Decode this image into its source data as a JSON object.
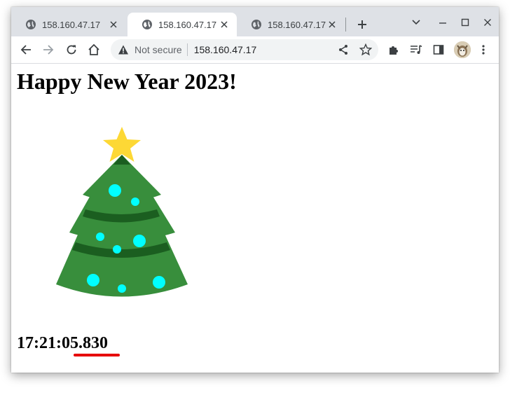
{
  "tabs": [
    {
      "title": "158.160.47.17",
      "active": false
    },
    {
      "title": "158.160.47.17",
      "active": true
    },
    {
      "title": "158.160.47.17",
      "active": false
    }
  ],
  "icons": {
    "tab": "globe-icon",
    "tab_close": "close-icon",
    "new_tab": "plus-icon",
    "tab_search": "chevron-down-icon",
    "minimize": "minimize-icon",
    "maximize": "maximize-icon",
    "close_window": "close-icon",
    "back": "back-arrow-icon",
    "forward": "forward-arrow-icon",
    "reload": "reload-icon",
    "home": "home-icon",
    "security": "warning-triangle-icon",
    "share": "share-icon",
    "bookmark": "star-icon",
    "extensions": "puzzle-icon",
    "media": "playlist-icon",
    "side_panel": "side-panel-icon",
    "menu": "kebab-menu-icon"
  },
  "omnibox": {
    "security_label": "Not secure",
    "url": "158.160.47.17"
  },
  "page": {
    "heading": "Happy New Year 2023!",
    "clock": "17:21:05.830"
  },
  "colors": {
    "tree_green": "#388e3c",
    "tree_dark_green": "#1b5e20",
    "ornament": "#00ffff",
    "star": "#fdd835",
    "underline": "#e60000"
  }
}
